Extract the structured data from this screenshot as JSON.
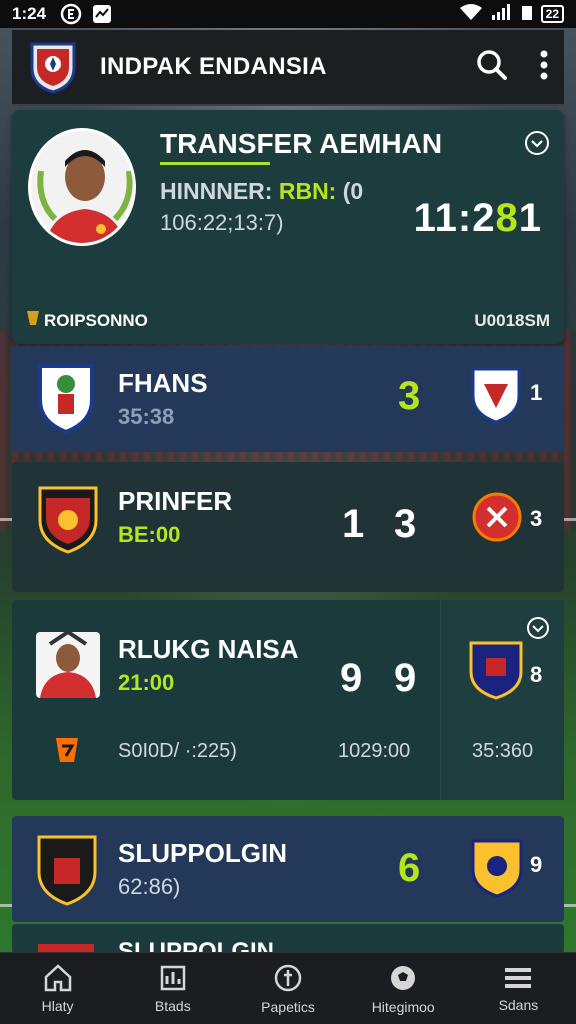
{
  "status_bar": {
    "time": "1:24",
    "battery": "22"
  },
  "app_bar": {
    "title": "INDPAK ENDANSIA",
    "icons": [
      "club-logo",
      "search-icon",
      "more-vertical-icon"
    ]
  },
  "feature": {
    "headline": "TRANSFER AEMHAN",
    "line2_label": "HINNNER: ",
    "line2_highlight": "RBN:",
    "line2_rest": " (0",
    "line3": "106:22;13:7)",
    "score_white": "11:2",
    "score_green": "8",
    "score_tail": "1",
    "footer_left": "ROIPSONNO",
    "footer_right": "U0018SM",
    "accent": "#b5e61d"
  },
  "matches": [
    {
      "name": "FHANS",
      "sub": "35:38",
      "score1": "",
      "score2": "3",
      "opp_score": "1",
      "sub_color": "#8ea0b8"
    },
    {
      "name": "PRINFER",
      "sub": "BE:00",
      "score1": "1",
      "score2": "3",
      "opp_score": "3",
      "sub_color": "#b5e61d"
    },
    {
      "name": "RLUKG NAISA",
      "sub": "21:00",
      "score1": "9",
      "score2": "9",
      "opp_score": "8",
      "sub_color": "#b5e61d",
      "extra_left": "S0I0D/ ·:225)",
      "extra_mid": "1029:00",
      "extra_right": "35:360"
    },
    {
      "name": "SLUPPOLGIN",
      "sub": "62:86)",
      "score1": "",
      "score2": "6",
      "opp_score": "9",
      "sub_color": "#cfd8dc"
    },
    {
      "name": "SLUPPOLGIN"
    }
  ],
  "bottom_nav": [
    {
      "label": "Hlaty",
      "icon": "home-icon"
    },
    {
      "label": "Btads",
      "icon": "stats-icon"
    },
    {
      "label": "Papetics",
      "icon": "compass-icon"
    },
    {
      "label": "Hitegimoo",
      "icon": "ball-icon"
    },
    {
      "label": "Sdans",
      "icon": "menu-icon"
    }
  ]
}
